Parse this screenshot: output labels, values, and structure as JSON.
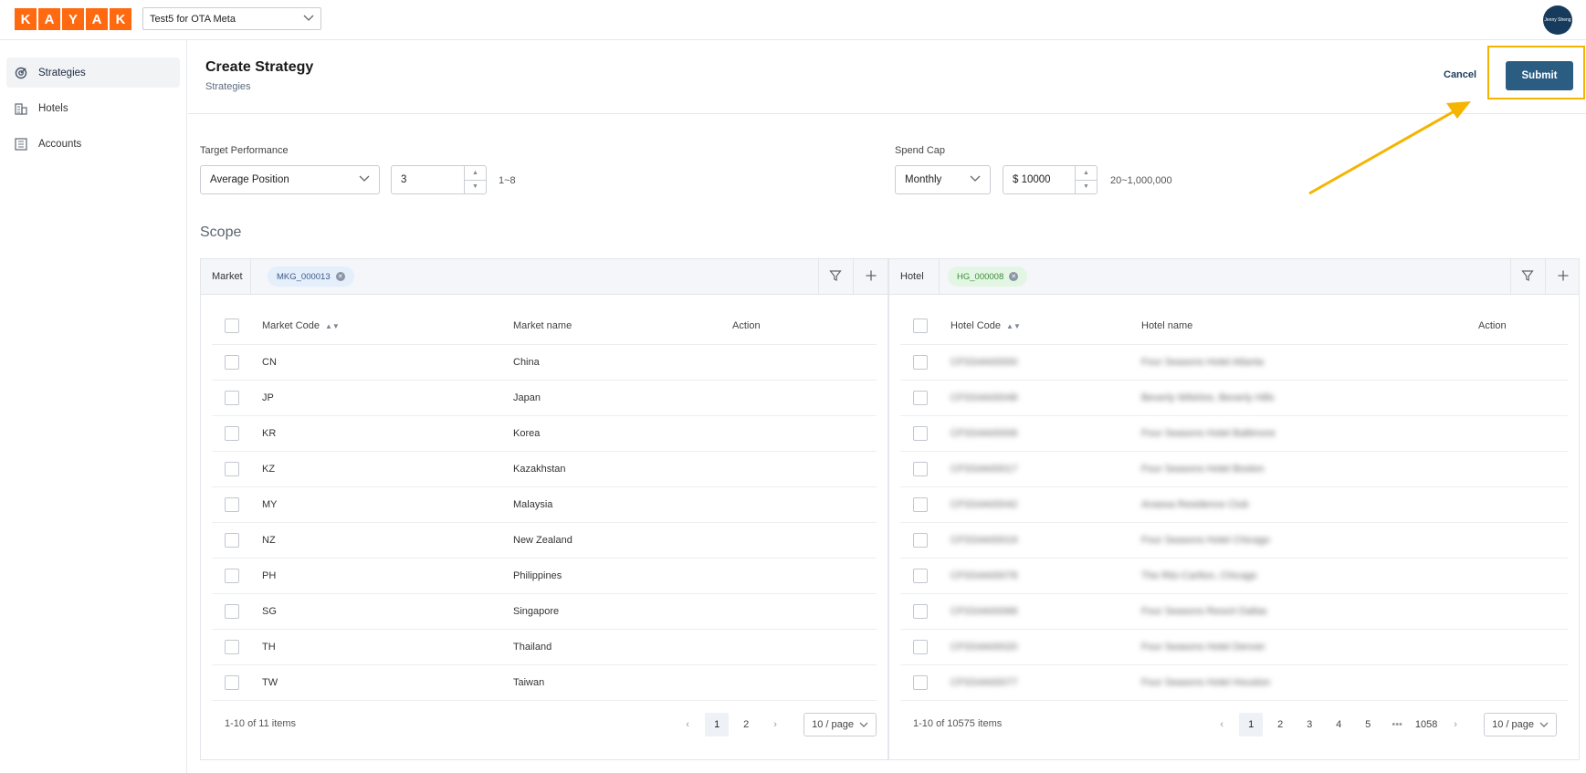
{
  "brand": {
    "letters": [
      "K",
      "A",
      "Y",
      "A",
      "K"
    ],
    "color": "#ff690f"
  },
  "account_selector": {
    "value": "Test5 for OTA Meta"
  },
  "user": {
    "avatar_text": "Jenny Sheng"
  },
  "sidebar": {
    "items": [
      {
        "label": "Strategies",
        "icon": "target-icon",
        "active": true
      },
      {
        "label": "Hotels",
        "icon": "building-icon",
        "active": false
      },
      {
        "label": "Accounts",
        "icon": "ledger-icon",
        "active": false
      }
    ]
  },
  "header": {
    "title": "Create Strategy",
    "breadcrumb": "Strategies",
    "cancel_label": "Cancel",
    "submit_label": "Submit"
  },
  "form": {
    "target_performance": {
      "label": "Target Performance",
      "metric": "Average Position",
      "value": "3",
      "range_hint": "1~8"
    },
    "spend_cap": {
      "label": "Spend Cap",
      "period": "Monthly",
      "value": "$ 10000",
      "range_hint": "20~1,000,000"
    }
  },
  "scope": {
    "title": "Scope",
    "market": {
      "label": "Market",
      "tag": "MKG_000013",
      "columns": [
        "Market Code",
        "Market name",
        "Action"
      ],
      "rows": [
        [
          "CN",
          "China"
        ],
        [
          "JP",
          "Japan"
        ],
        [
          "KR",
          "Korea"
        ],
        [
          "KZ",
          "Kazakhstan"
        ],
        [
          "MY",
          "Malaysia"
        ],
        [
          "NZ",
          "New Zealand"
        ],
        [
          "PH",
          "Philippines"
        ],
        [
          "SG",
          "Singapore"
        ],
        [
          "TH",
          "Thailand"
        ],
        [
          "TW",
          "Taiwan"
        ]
      ],
      "pagination": {
        "summary": "1-10 of 11 items",
        "pages": [
          "1",
          "2"
        ],
        "current": "1",
        "page_size": "10 / page"
      }
    },
    "hotel": {
      "label": "Hotel",
      "tag": "HG_000008",
      "columns": [
        "Hotel Code",
        "Hotel name",
        "Action"
      ],
      "rows": [
        [
          "CFSS4A00000",
          "Four Seasons Hotel Atlanta"
        ],
        [
          "CFSS4A00048",
          "Beverly Wilshire, Beverly Hills"
        ],
        [
          "CFSS4A00006",
          "Four Seasons Hotel Baltimore"
        ],
        [
          "CFSS4A00017",
          "Four Seasons Hotel Boston"
        ],
        [
          "CFSS4A00042",
          "Anassa Residence Club"
        ],
        [
          "CFSS4A00019",
          "Four Seasons Hotel Chicago"
        ],
        [
          "CFSS4A00078",
          "The Ritz-Carlton, Chicago"
        ],
        [
          "CFSS4A00068",
          "Four Seasons Resort Dallas"
        ],
        [
          "CFSS4A00020",
          "Four Seasons Hotel Denver"
        ],
        [
          "CFSS4A00077",
          "Four Seasons Hotel Houston"
        ]
      ],
      "pagination": {
        "summary": "1-10 of 10575 items",
        "pages": [
          "1",
          "2",
          "3",
          "4",
          "5",
          "•••",
          "1058"
        ],
        "current": "1",
        "page_size": "10 / page"
      }
    }
  },
  "annotation": {
    "color": "#f5b400",
    "target": "Submit"
  }
}
